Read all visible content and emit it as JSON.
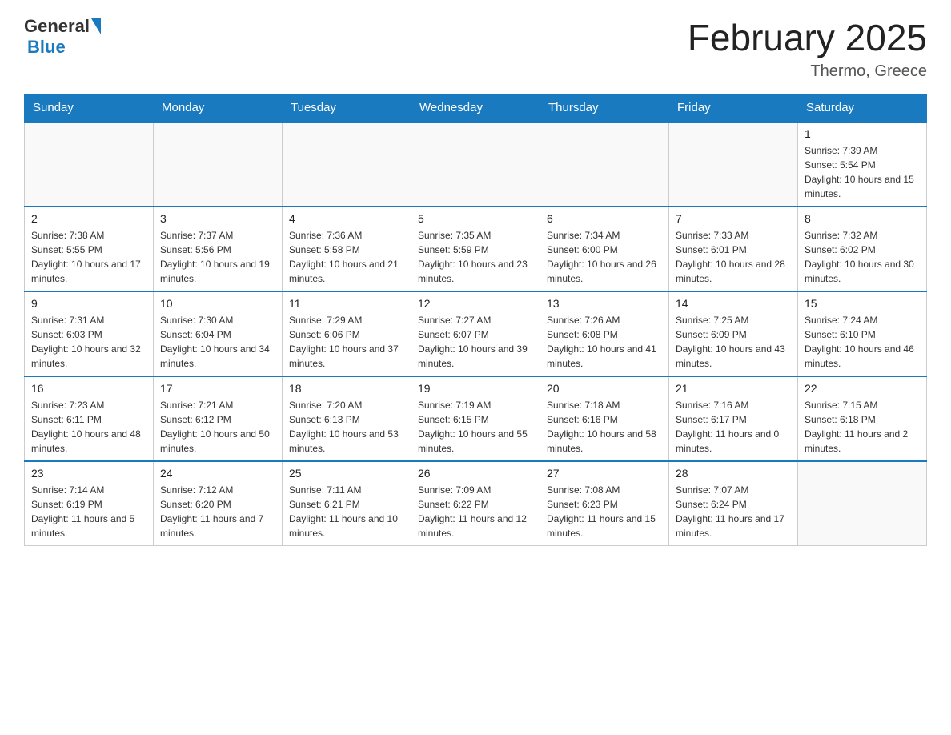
{
  "header": {
    "logo_general": "General",
    "logo_blue": "Blue",
    "month_title": "February 2025",
    "location": "Thermo, Greece"
  },
  "days_of_week": [
    "Sunday",
    "Monday",
    "Tuesday",
    "Wednesday",
    "Thursday",
    "Friday",
    "Saturday"
  ],
  "weeks": [
    [
      {
        "day": "",
        "sunrise": "",
        "sunset": "",
        "daylight": ""
      },
      {
        "day": "",
        "sunrise": "",
        "sunset": "",
        "daylight": ""
      },
      {
        "day": "",
        "sunrise": "",
        "sunset": "",
        "daylight": ""
      },
      {
        "day": "",
        "sunrise": "",
        "sunset": "",
        "daylight": ""
      },
      {
        "day": "",
        "sunrise": "",
        "sunset": "",
        "daylight": ""
      },
      {
        "day": "",
        "sunrise": "",
        "sunset": "",
        "daylight": ""
      },
      {
        "day": "1",
        "sunrise": "Sunrise: 7:39 AM",
        "sunset": "Sunset: 5:54 PM",
        "daylight": "Daylight: 10 hours and 15 minutes."
      }
    ],
    [
      {
        "day": "2",
        "sunrise": "Sunrise: 7:38 AM",
        "sunset": "Sunset: 5:55 PM",
        "daylight": "Daylight: 10 hours and 17 minutes."
      },
      {
        "day": "3",
        "sunrise": "Sunrise: 7:37 AM",
        "sunset": "Sunset: 5:56 PM",
        "daylight": "Daylight: 10 hours and 19 minutes."
      },
      {
        "day": "4",
        "sunrise": "Sunrise: 7:36 AM",
        "sunset": "Sunset: 5:58 PM",
        "daylight": "Daylight: 10 hours and 21 minutes."
      },
      {
        "day": "5",
        "sunrise": "Sunrise: 7:35 AM",
        "sunset": "Sunset: 5:59 PM",
        "daylight": "Daylight: 10 hours and 23 minutes."
      },
      {
        "day": "6",
        "sunrise": "Sunrise: 7:34 AM",
        "sunset": "Sunset: 6:00 PM",
        "daylight": "Daylight: 10 hours and 26 minutes."
      },
      {
        "day": "7",
        "sunrise": "Sunrise: 7:33 AM",
        "sunset": "Sunset: 6:01 PM",
        "daylight": "Daylight: 10 hours and 28 minutes."
      },
      {
        "day": "8",
        "sunrise": "Sunrise: 7:32 AM",
        "sunset": "Sunset: 6:02 PM",
        "daylight": "Daylight: 10 hours and 30 minutes."
      }
    ],
    [
      {
        "day": "9",
        "sunrise": "Sunrise: 7:31 AM",
        "sunset": "Sunset: 6:03 PM",
        "daylight": "Daylight: 10 hours and 32 minutes."
      },
      {
        "day": "10",
        "sunrise": "Sunrise: 7:30 AM",
        "sunset": "Sunset: 6:04 PM",
        "daylight": "Daylight: 10 hours and 34 minutes."
      },
      {
        "day": "11",
        "sunrise": "Sunrise: 7:29 AM",
        "sunset": "Sunset: 6:06 PM",
        "daylight": "Daylight: 10 hours and 37 minutes."
      },
      {
        "day": "12",
        "sunrise": "Sunrise: 7:27 AM",
        "sunset": "Sunset: 6:07 PM",
        "daylight": "Daylight: 10 hours and 39 minutes."
      },
      {
        "day": "13",
        "sunrise": "Sunrise: 7:26 AM",
        "sunset": "Sunset: 6:08 PM",
        "daylight": "Daylight: 10 hours and 41 minutes."
      },
      {
        "day": "14",
        "sunrise": "Sunrise: 7:25 AM",
        "sunset": "Sunset: 6:09 PM",
        "daylight": "Daylight: 10 hours and 43 minutes."
      },
      {
        "day": "15",
        "sunrise": "Sunrise: 7:24 AM",
        "sunset": "Sunset: 6:10 PM",
        "daylight": "Daylight: 10 hours and 46 minutes."
      }
    ],
    [
      {
        "day": "16",
        "sunrise": "Sunrise: 7:23 AM",
        "sunset": "Sunset: 6:11 PM",
        "daylight": "Daylight: 10 hours and 48 minutes."
      },
      {
        "day": "17",
        "sunrise": "Sunrise: 7:21 AM",
        "sunset": "Sunset: 6:12 PM",
        "daylight": "Daylight: 10 hours and 50 minutes."
      },
      {
        "day": "18",
        "sunrise": "Sunrise: 7:20 AM",
        "sunset": "Sunset: 6:13 PM",
        "daylight": "Daylight: 10 hours and 53 minutes."
      },
      {
        "day": "19",
        "sunrise": "Sunrise: 7:19 AM",
        "sunset": "Sunset: 6:15 PM",
        "daylight": "Daylight: 10 hours and 55 minutes."
      },
      {
        "day": "20",
        "sunrise": "Sunrise: 7:18 AM",
        "sunset": "Sunset: 6:16 PM",
        "daylight": "Daylight: 10 hours and 58 minutes."
      },
      {
        "day": "21",
        "sunrise": "Sunrise: 7:16 AM",
        "sunset": "Sunset: 6:17 PM",
        "daylight": "Daylight: 11 hours and 0 minutes."
      },
      {
        "day": "22",
        "sunrise": "Sunrise: 7:15 AM",
        "sunset": "Sunset: 6:18 PM",
        "daylight": "Daylight: 11 hours and 2 minutes."
      }
    ],
    [
      {
        "day": "23",
        "sunrise": "Sunrise: 7:14 AM",
        "sunset": "Sunset: 6:19 PM",
        "daylight": "Daylight: 11 hours and 5 minutes."
      },
      {
        "day": "24",
        "sunrise": "Sunrise: 7:12 AM",
        "sunset": "Sunset: 6:20 PM",
        "daylight": "Daylight: 11 hours and 7 minutes."
      },
      {
        "day": "25",
        "sunrise": "Sunrise: 7:11 AM",
        "sunset": "Sunset: 6:21 PM",
        "daylight": "Daylight: 11 hours and 10 minutes."
      },
      {
        "day": "26",
        "sunrise": "Sunrise: 7:09 AM",
        "sunset": "Sunset: 6:22 PM",
        "daylight": "Daylight: 11 hours and 12 minutes."
      },
      {
        "day": "27",
        "sunrise": "Sunrise: 7:08 AM",
        "sunset": "Sunset: 6:23 PM",
        "daylight": "Daylight: 11 hours and 15 minutes."
      },
      {
        "day": "28",
        "sunrise": "Sunrise: 7:07 AM",
        "sunset": "Sunset: 6:24 PM",
        "daylight": "Daylight: 11 hours and 17 minutes."
      },
      {
        "day": "",
        "sunrise": "",
        "sunset": "",
        "daylight": ""
      }
    ]
  ]
}
